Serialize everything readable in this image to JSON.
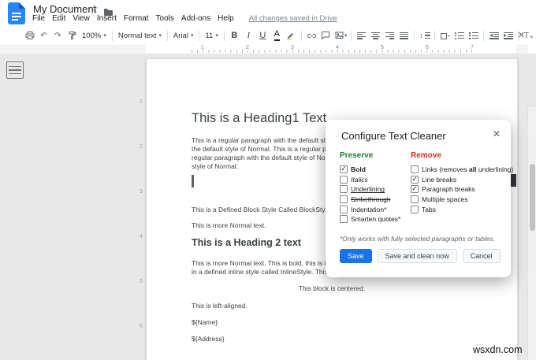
{
  "icons": {
    "star": "☆",
    "undo": "↶",
    "redo": "↷",
    "caret": "▾",
    "close": "✕",
    "updown": "↕",
    "check": "✓",
    "clear_t": "T",
    "clear_x": "✕"
  },
  "header": {
    "title": "My Document",
    "menus": [
      "File",
      "Edit",
      "View",
      "Insert",
      "Format",
      "Tools",
      "Add-ons",
      "Help"
    ],
    "saved": "All changes saved in Drive"
  },
  "toolbar": {
    "zoom": "100%",
    "paragraph_style": "Normal text",
    "font": "Arial",
    "font_size": "11",
    "bold_label": "B",
    "italic_label": "I",
    "underline_label": "U",
    "text_color_label": "A"
  },
  "ruler": {
    "marks": [
      "1",
      "2",
      "3",
      "4",
      "5",
      "6",
      "7"
    ],
    "vmarks": [
      "1",
      "2",
      "3",
      "4",
      "5",
      "6"
    ]
  },
  "doc": {
    "heading1": "This is a Heading1 Text",
    "p1_l1": "This is a regular paragraph with the default style of Normal. This is a regular paragraph with",
    "p1_l2": "the default style of Normal. This is a regular paragraph with the default style of Normal. This is a",
    "p1_l3": "regular paragraph with the default style of Normal. This is a regular paragraph with the default",
    "p1_l4": "style of Normal.",
    "block_line": "This is a Defined Block Style Called BlockStyle. This is a Defined Block Style.",
    "normal1": "This is more Normal text.",
    "heading2": "This is a Heading 2 text",
    "p2_l1": "This is more Normal text. This is bold, this is italic, this is underlined, and this is text",
    "p2_l2": "in a defined inline style called InlineStyle. This is more Normal text.",
    "centered": "This block is centered.",
    "left_aligned": "This is left-aligned.",
    "name_field": "${Name}",
    "address_field": "${Address}"
  },
  "dialog": {
    "title": "Configure Text Cleaner",
    "preserve": {
      "title": "Preserve",
      "items": [
        {
          "label": "Bold",
          "checked": true
        },
        {
          "label": "Italics",
          "checked": false
        },
        {
          "label": "Underlining",
          "checked": false
        },
        {
          "label": "Strikethrough",
          "checked": false
        },
        {
          "label": "Indentation*",
          "checked": false
        },
        {
          "label": "Smarten quotes*",
          "checked": false
        }
      ]
    },
    "remove": {
      "title": "Remove",
      "items": [
        {
          "pre": "Links (removes ",
          "bold": "all",
          "post": " underlining)",
          "checked": false
        },
        {
          "label": "Line breaks",
          "checked": true
        },
        {
          "label": "Paragraph breaks",
          "checked": true
        },
        {
          "label": "Multiple spaces",
          "checked": false
        },
        {
          "label": "Tabs",
          "checked": false
        }
      ]
    },
    "note": "*Only works with fully selected paragraphs or tables.",
    "buttons": {
      "save": "Save",
      "save_clean": "Save and clean now",
      "cancel": "Cancel"
    }
  },
  "page": {
    "watermark": "wsxdn.com"
  }
}
